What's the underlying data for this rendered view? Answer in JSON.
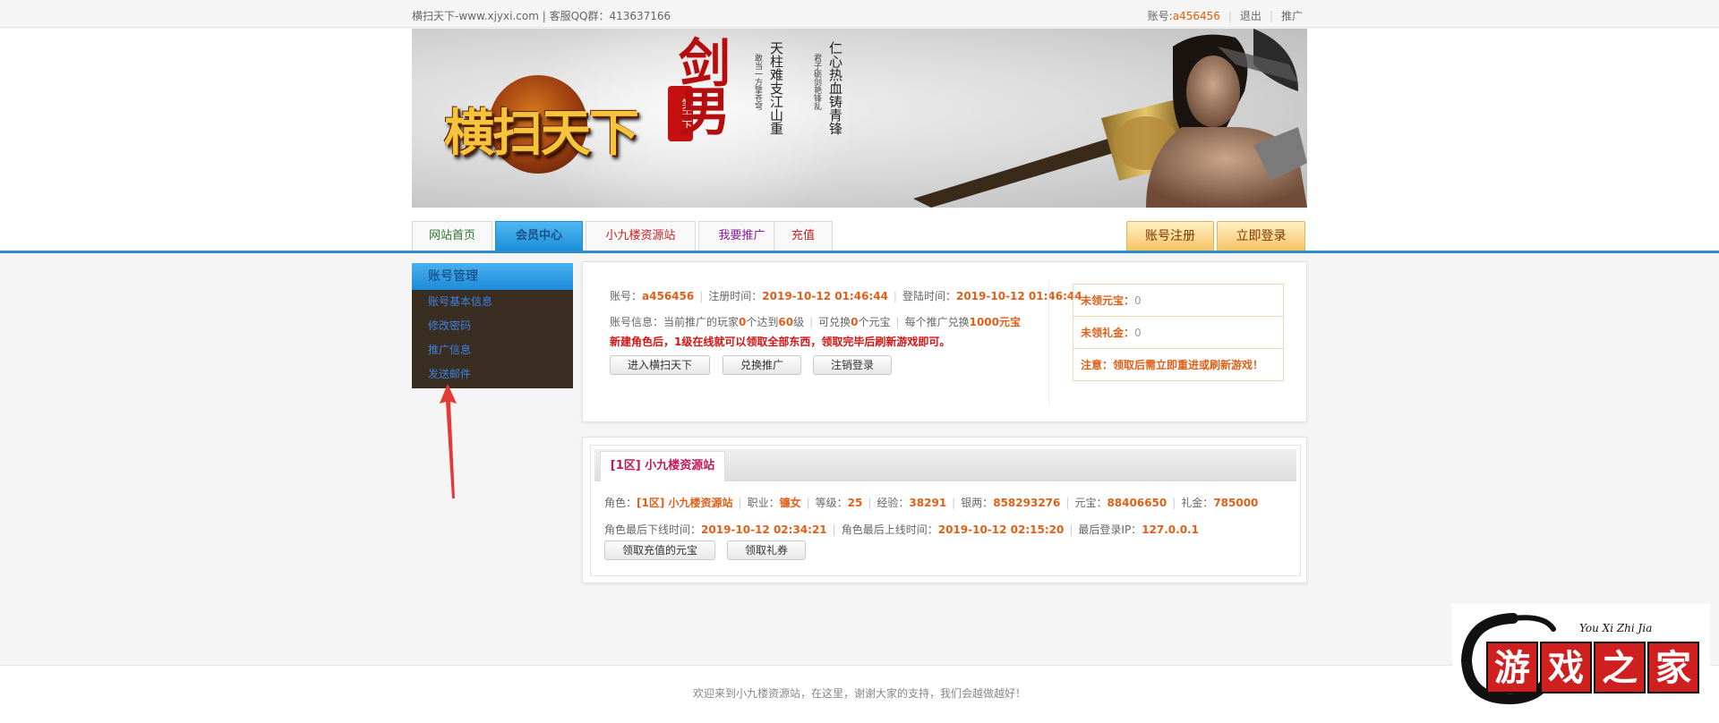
{
  "topbar": {
    "site_text": "横扫天下-www.xjyxi.com | 客服QQ群：413637166",
    "account_label": "账号:",
    "account_name": "a456456",
    "logout": "退出",
    "promote": "推广"
  },
  "banner": {
    "logo_text": "横扫天下",
    "logo_seal": "笑天下",
    "title_vertical": "剑男",
    "poem_line1": "天柱难支江山重",
    "poem_line1_small": "敢当一方擎苍穹",
    "poem_line2": "仁心热血铸青锋",
    "poem_line2_small": "君子砺剑艳锋乱"
  },
  "nav": {
    "tabs": [
      "网站首页",
      "会员中心",
      "小九楼资源站",
      "我要推广",
      "充值"
    ],
    "register": "账号注册",
    "login": "立即登录"
  },
  "sidebar": {
    "title": "账号管理",
    "items": [
      "账号基本信息",
      "修改密码",
      "推广信息",
      "发送邮件"
    ]
  },
  "account_panel": {
    "account_label": "账号：",
    "account": "a456456",
    "reg_label": "注册时间：",
    "reg_time": "2019-10-12 01:46:44",
    "login_label": "登陆时间：",
    "login_time": "2019-10-12 01:46:44",
    "info_label": "账号信息：当前推广的玩家",
    "info_count": "0",
    "info_mid": "个达到",
    "info_level": "60",
    "info_mid2": "级",
    "exchange_label": "可兑换",
    "exchange_count": "0",
    "exchange_unit": "个元宝",
    "per_label": "每个推广兑换",
    "per_value": "1000元宝",
    "notice": "新建角色后，1级在线就可以领取全部东西，领取完毕后刷新游戏即可。",
    "buttons": [
      "进入横扫天下",
      "兑换推广",
      "注销登录"
    ],
    "side": {
      "unclaimed_yb_label": "未领元宝：",
      "unclaimed_yb": "0",
      "unclaimed_lj_label": "未领礼金：",
      "unclaimed_lj": "0",
      "tip": "注意：领取后需立即重进或刷新游戏！"
    }
  },
  "role_panel": {
    "tab": "[1区] 小九楼资源站",
    "role_label": "角色：",
    "role": "[1区] 小九楼资源站",
    "job_label": "职业：",
    "job": "镰女",
    "level_label": "等级：",
    "level": "25",
    "exp_label": "经验：",
    "exp": "38291",
    "silver_label": "银两：",
    "silver": "858293276",
    "yb_label": "元宝：",
    "yb": "88406650",
    "lj_label": "礼金：",
    "lj": "785000",
    "last_off_label": "角色最后下线时间：",
    "last_off": "2019-10-12 02:34:21",
    "last_on_label": "角色最后上线时间：",
    "last_on": "2019-10-12 02:15:20",
    "ip_label": "最后登录IP：",
    "ip": "127.0.0.1",
    "buttons": [
      "领取充值的元宝",
      "领取礼券"
    ]
  },
  "footer": {
    "text": "欢迎来到小九楼资源站，在这里，谢谢大家的支持，我们会越做越好！"
  },
  "watermark": {
    "en": "You Xi Zhi Jia",
    "cn": [
      "游",
      "戏",
      "之",
      "家"
    ]
  },
  "colors": {
    "accent_blue": "#2b8cd2",
    "orange": "#e0601a",
    "red": "#d01515"
  }
}
